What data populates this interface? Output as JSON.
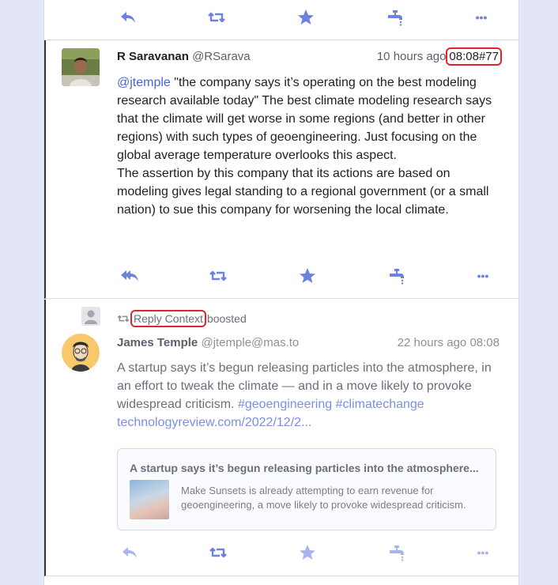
{
  "colors": {
    "accent": "#6c83de",
    "faded": "#a8b5ec",
    "highlight": "#e0242e"
  },
  "top_actions": {
    "icons": [
      "reply-icon",
      "boost-icon",
      "favourite-icon",
      "bookmark-faucet-icon",
      "more-icon"
    ],
    "more": "•••"
  },
  "status1": {
    "author_name": "R Saravanan",
    "author_handle": "@RSarava",
    "relative_time": "10 hours ago",
    "timestamp": "08:08#77",
    "mention": "@jtemple",
    "text1": " \"the company says it’s operating on the best modeling research available today\" The best climate modeling research says that the climate will get worse in some regions (and better in other regions) with such types of geoengineering. Just focusing on the global average temperature overlooks this aspect.",
    "text2": "The assertion by this company that its actions are based on modeling gives legal standing to a regional government (or a small nation) to sue this company for worsening the local climate.",
    "more": "•••"
  },
  "status2": {
    "boost_link": "Reply Context",
    "boosted_label": "boosted",
    "author_name": "James Temple",
    "author_handle": "@jtemple@mas.to",
    "relative_time": "22 hours ago",
    "timestamp": "08:08",
    "text": "A startup says it’s begun releasing particles into the atmosphere, in an effort to tweak the climate — and in a move likely to provoke widespread criticism. ",
    "hashtag1": "#geoengineering",
    "hashtag2": "#climatechange",
    "link": "technologyreview.com/2022/12/2...",
    "card_title": "A startup says it’s begun releasing particles into the atmosphere...",
    "card_desc": "Make Sunsets is already attempting to earn revenue for geoengineering, a move likely to provoke widespread criticism.",
    "more": "•••"
  }
}
